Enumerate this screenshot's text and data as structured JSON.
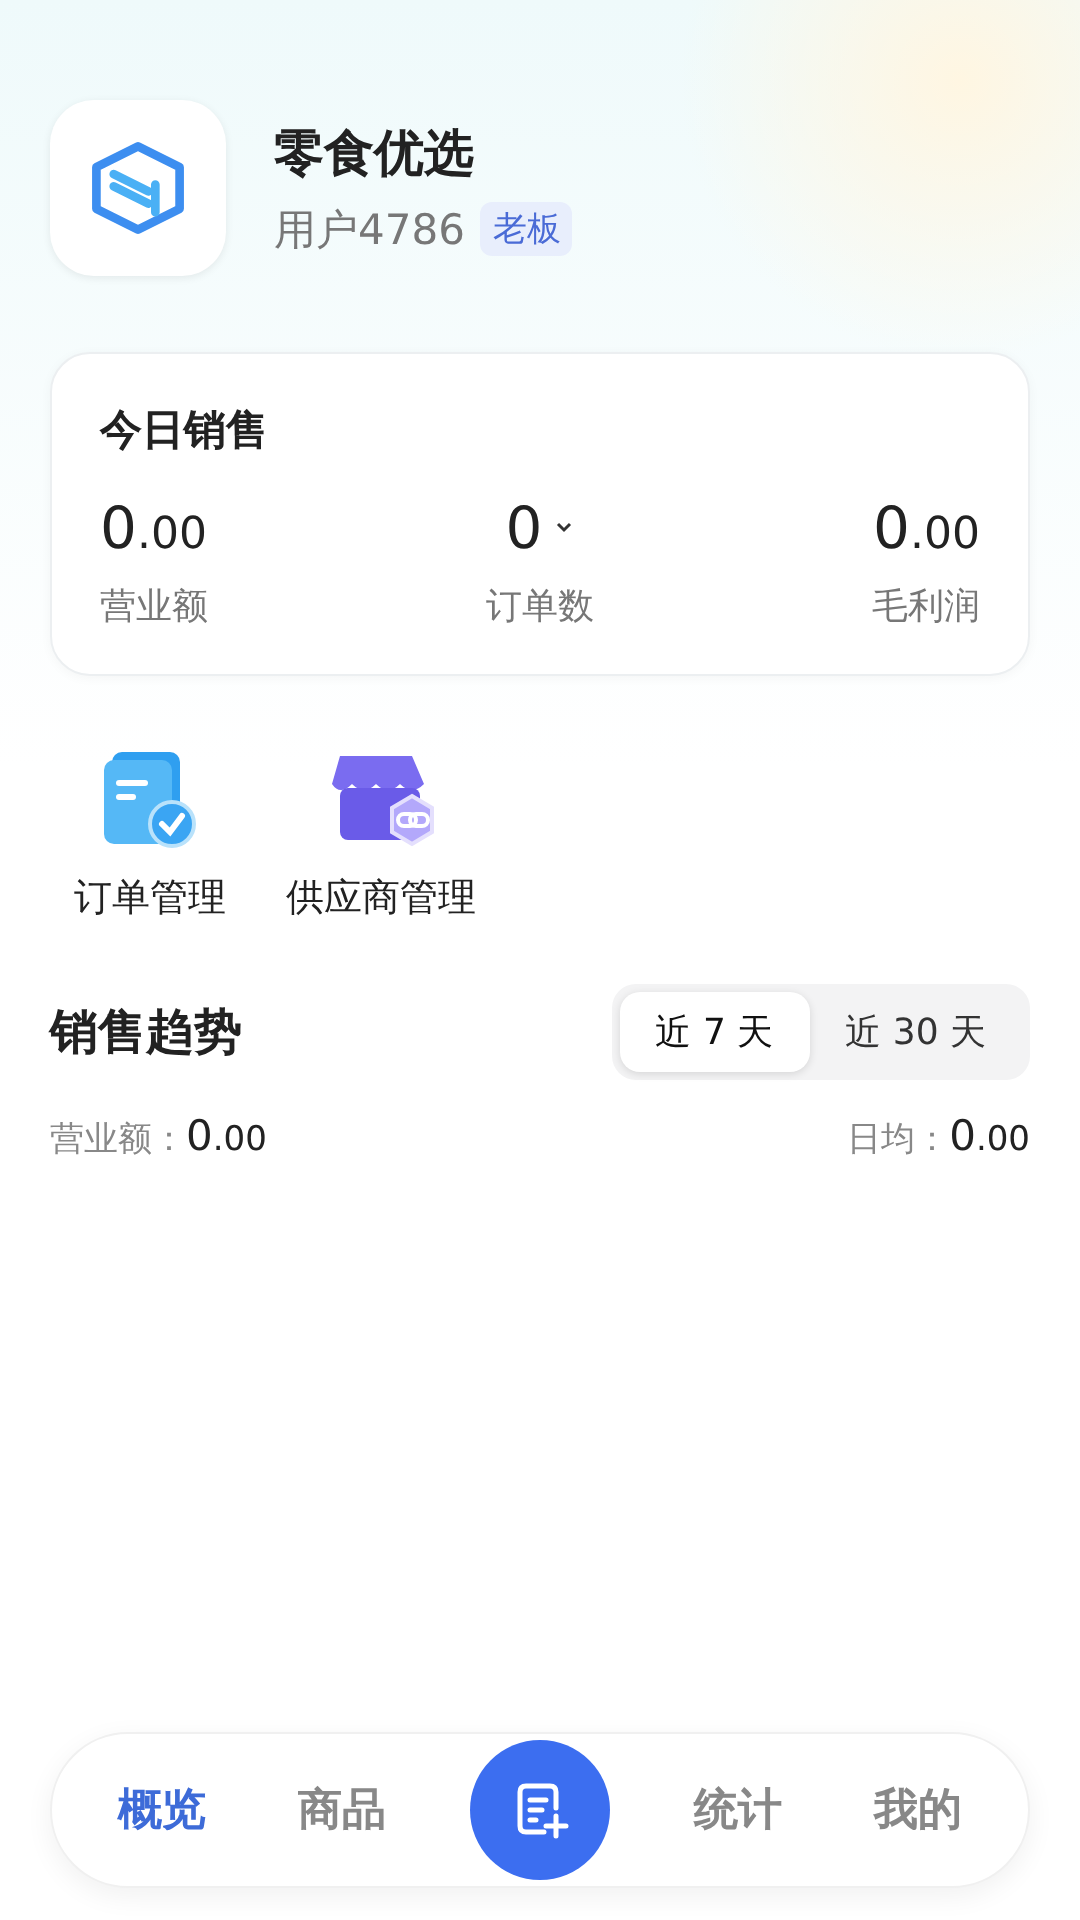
{
  "profile": {
    "name": "零食优选",
    "user": "用户4786",
    "role_badge": "老板"
  },
  "today_sales": {
    "title": "今日销售",
    "metrics": [
      {
        "integer": "0",
        "decimal": ".00",
        "label": "营业额",
        "kind": "money"
      },
      {
        "integer": "0",
        "label": "订单数",
        "kind": "dropdown"
      },
      {
        "integer": "0",
        "decimal": ".00",
        "label": "毛利润",
        "kind": "money"
      }
    ]
  },
  "shortcuts": [
    {
      "label": "订单管理",
      "kind": "orders"
    },
    {
      "label": "供应商管理",
      "kind": "supplier"
    }
  ],
  "trend": {
    "title": "销售趋势",
    "periods": [
      {
        "label": "近 7 天",
        "selected": true
      },
      {
        "label": "近 30 天",
        "selected": false
      }
    ],
    "summary": [
      {
        "label": "营业额：",
        "integer": "0",
        "decimal": ".00"
      },
      {
        "label": "日均：",
        "integer": "0",
        "decimal": ".00"
      }
    ]
  },
  "bottom_nav": [
    {
      "label": "概览",
      "kind": "tab",
      "selected": true
    },
    {
      "label": "商品",
      "kind": "tab",
      "selected": false
    },
    {
      "kind": "action"
    },
    {
      "label": "统计",
      "kind": "tab",
      "selected": false
    },
    {
      "label": "我的",
      "kind": "tab",
      "selected": false
    }
  ]
}
